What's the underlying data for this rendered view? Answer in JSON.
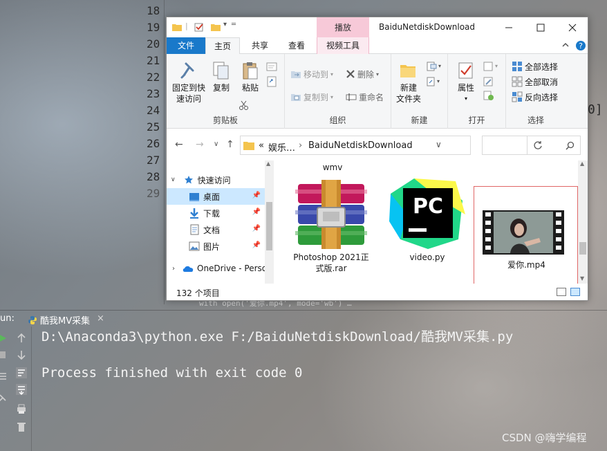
{
  "ide": {
    "line_numbers": [
      "18",
      "19",
      "20",
      "21",
      "22",
      "23",
      "24",
      "25",
      "26",
      "27",
      "28",
      "29"
    ],
    "code_fragment": "0]",
    "ghost_line": "with open('爱你.mp4', mode='wb') …",
    "run": {
      "label": "un:",
      "tab_label": "酷我MV采集",
      "tab_close": "×"
    },
    "console": {
      "line1": "D:\\Anaconda3\\python.exe F:/BaiduNetdiskDownload/酷我MV采集.py",
      "line2": "Process finished with exit code 0"
    },
    "watermark": "CSDN @嗨学编程"
  },
  "explorer": {
    "title": "BaiduNetdiskDownload",
    "context_tab": "播放",
    "tabs": {
      "file": "文件",
      "home": "主页",
      "share": "共享",
      "view": "查看",
      "video_tools": "视频工具"
    },
    "ribbon": {
      "clipboard": {
        "label": "剪贴板",
        "pin_line1": "固定到快",
        "pin_line2": "速访问",
        "copy": "复制",
        "paste": "粘贴"
      },
      "organize": {
        "label": "组织",
        "move_to": "移动到",
        "copy_to": "复制到",
        "delete": "删除",
        "rename": "重命名"
      },
      "new": {
        "label": "新建",
        "new_folder_line1": "新建",
        "new_folder_line2": "文件夹"
      },
      "open": {
        "label": "打开",
        "properties": "属性"
      },
      "select": {
        "label": "选择",
        "select_all": "全部选择",
        "select_none": "全部取消",
        "invert": "反向选择"
      }
    },
    "address": {
      "prefix": "«",
      "crumb1": "娱乐…",
      "sep": "›",
      "crumb2": "BaiduNetdiskDownload"
    },
    "nav": {
      "quick_access": "快速访问",
      "desktop": "桌面",
      "downloads": "下载",
      "documents": "文档",
      "pictures": "图片",
      "onedrive": "OneDrive - Perso"
    },
    "files": {
      "top_label": "wmv",
      "rar_line1": "Photoshop 2021正",
      "rar_line2": "式版.rar",
      "py": "video.py",
      "mp4": "爱你.mp4"
    },
    "status": {
      "count": "132 个项目"
    }
  },
  "colors": {
    "accent": "#1979ca",
    "context_tab": "#f7c9d8",
    "selection": "#cce8ff",
    "highlight_border": "#e06666"
  }
}
